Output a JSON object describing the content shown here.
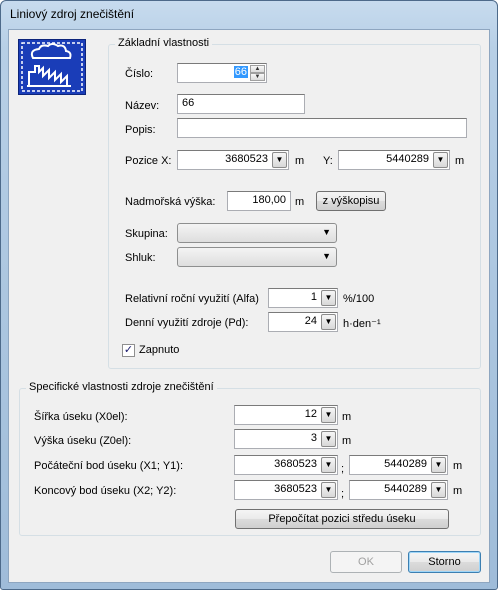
{
  "window": {
    "title": "Liniový zdroj znečištění"
  },
  "logo": {
    "icon": "factory-smoke-icon",
    "color": "#1a3db8"
  },
  "basic": {
    "title": "Základní vlastnosti",
    "cislo_label": "Číslo:",
    "cislo_value": "66",
    "nazev_label": "Název:",
    "nazev_value": "66",
    "popis_label": "Popis:",
    "popis_value": "",
    "pozice_x_label": "Pozice X:",
    "pozice_x_value": "3680523",
    "pozice_x_unit": "m",
    "pozice_y_label": "Y:",
    "pozice_y_value": "5440289",
    "pozice_y_unit": "m",
    "vyska_label": "Nadmořská výška:",
    "vyska_value": "180,00",
    "vyska_unit": "m",
    "vyskopis_button": "z výškopisu",
    "skupina_label": "Skupina:",
    "skupina_value": "",
    "shluk_label": "Shluk:",
    "shluk_value": "",
    "alfa_label": "Relativní roční využití  (Alfa)",
    "alfa_value": "1",
    "alfa_unit": "%/100",
    "pd_label": "Denní využití zdroje (Pd):",
    "pd_value": "24",
    "pd_unit": "h·den⁻¹",
    "zapnuto_label": "Zapnuto",
    "zapnuto_checked": true
  },
  "specific": {
    "title": "Specifické vlastnosti zdroje znečištění",
    "sirka_label": "Šířka úseku (X0el):",
    "sirka_value": "12",
    "sirka_unit": "m",
    "vyska_label": "Výška úseku (Z0el):",
    "vyska_value": "3",
    "vyska_unit": "m",
    "pocatecni_label": "Počáteční bod úseku (X1; Y1):",
    "pocatecni_x": "3680523",
    "pocatecni_sep": ";",
    "pocatecni_y": "5440289",
    "pocatecni_unit": "m",
    "koncovy_label": "Koncový bod úseku (X2; Y2):",
    "koncovy_x": "3680523",
    "koncovy_sep": ";",
    "koncovy_y": "5440289",
    "koncovy_unit": "m",
    "prepocitat_button": "Přepočítat pozici středu úseku"
  },
  "footer": {
    "ok": "OK",
    "cancel": "Storno"
  }
}
